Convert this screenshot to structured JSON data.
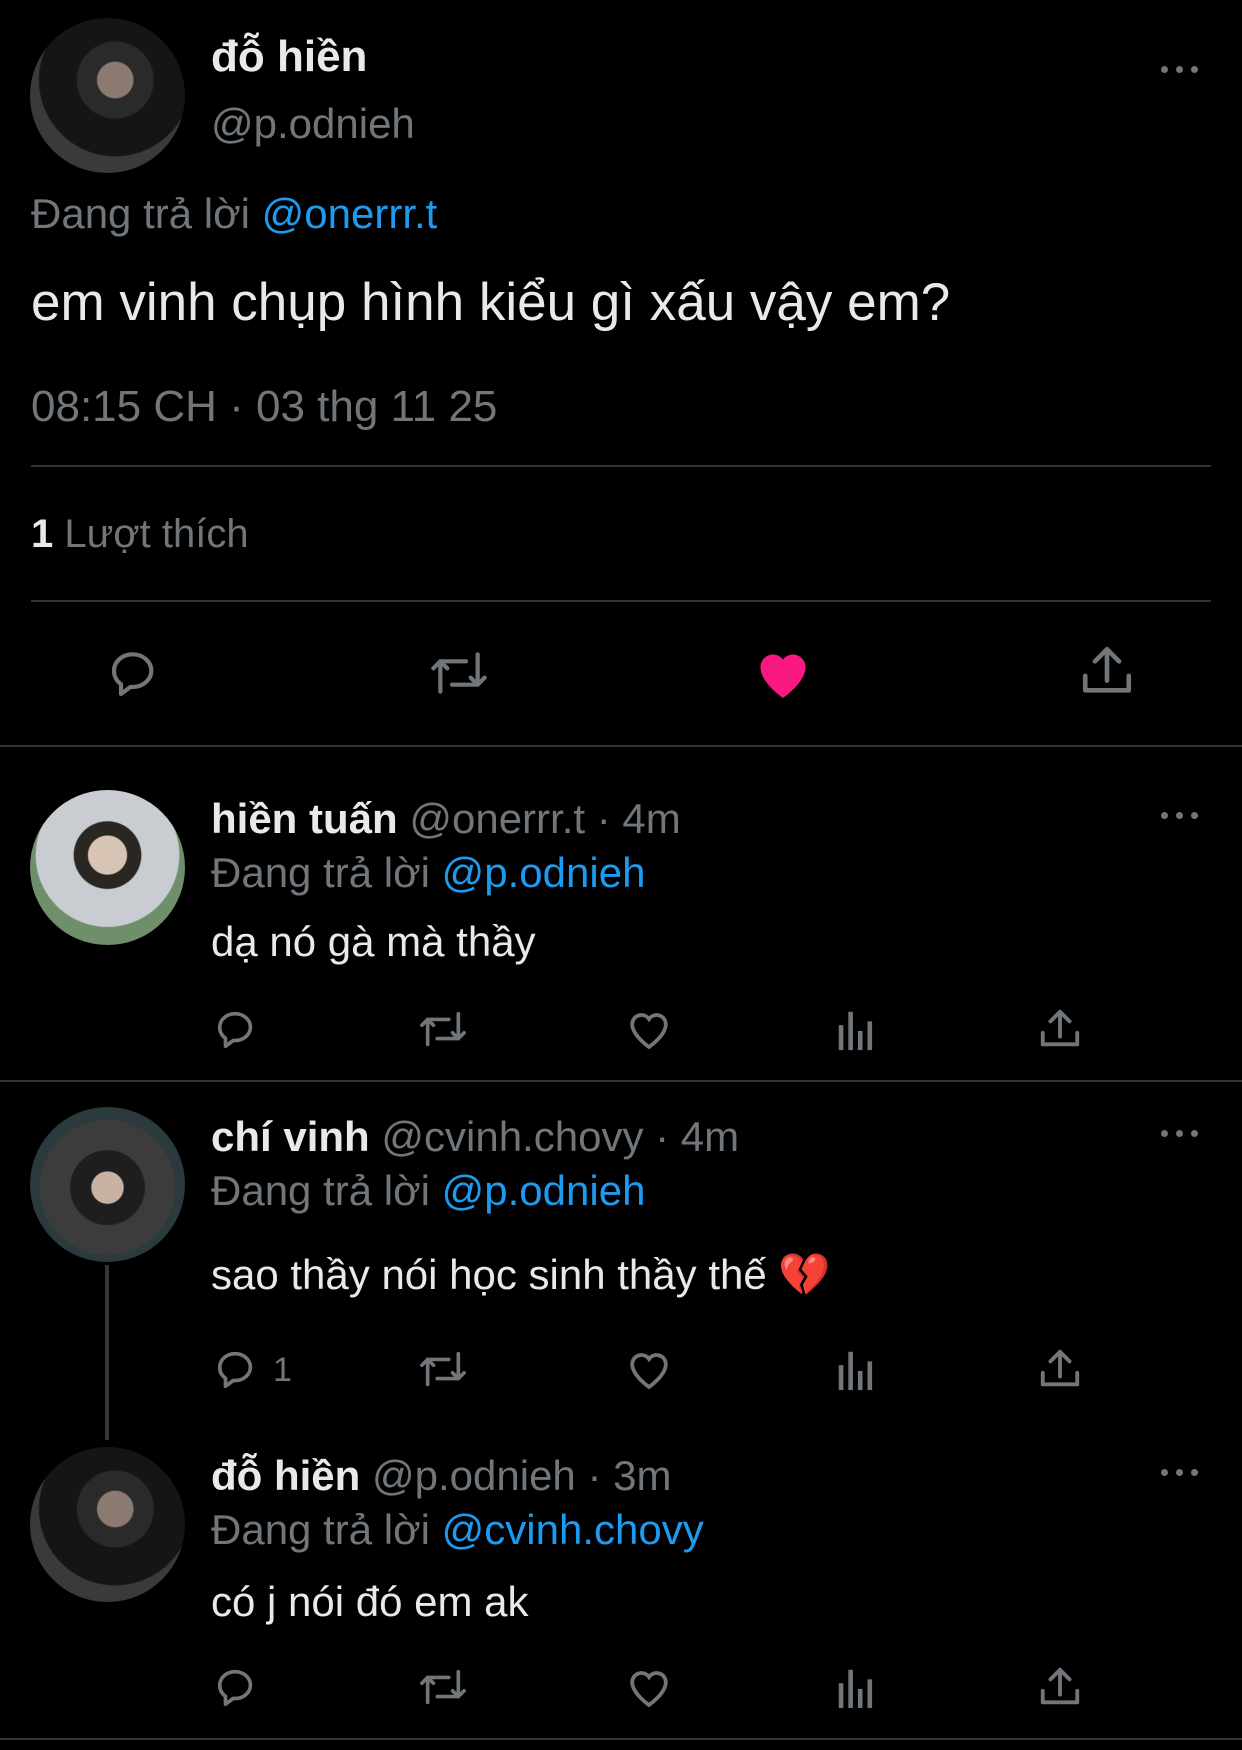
{
  "main_tweet": {
    "author_name": "đỗ hiền",
    "author_handle": "@p.odnieh",
    "replying_label": "Đang trả lời",
    "replying_to": "@onerrr.t",
    "text": "em vinh chụp hình kiểu gì xấu vậy em?",
    "timestamp": "08:15 CH · 03 thg 11 25",
    "likes_count": "1",
    "likes_label": "Lượt thích",
    "liked": true
  },
  "replies": [
    {
      "author_name": "hiền tuấn",
      "author_handle": "@onerrr.t",
      "time": "· 4m",
      "replying_label": "Đang trả lời",
      "replying_to": "@p.odnieh",
      "text": "dạ nó gà mà thầy",
      "reply_count": ""
    },
    {
      "author_name": "chí vinh",
      "author_handle": "@cvinh.chovy",
      "time": "· 4m",
      "replying_label": "Đang trả lời",
      "replying_to": "@p.odnieh",
      "text": "sao thầy nói học sinh thầy thế",
      "emoji": "💔",
      "reply_count": "1"
    },
    {
      "author_name": "đỗ hiền",
      "author_handle": "@p.odnieh",
      "time": "· 3m",
      "replying_label": "Đang trả lời",
      "replying_to": "@cvinh.chovy",
      "text": "có j nói đó em ak",
      "reply_count": ""
    }
  ],
  "colors": {
    "background": "#000000",
    "text": "#e7e9ea",
    "muted": "#71767b",
    "link": "#1d9bf0",
    "like": "#f91880",
    "divider": "#2f3336"
  },
  "icons": [
    "more-icon",
    "reply-icon",
    "retweet-icon",
    "heart-icon",
    "share-icon",
    "views-icon",
    "broken-heart-icon"
  ]
}
